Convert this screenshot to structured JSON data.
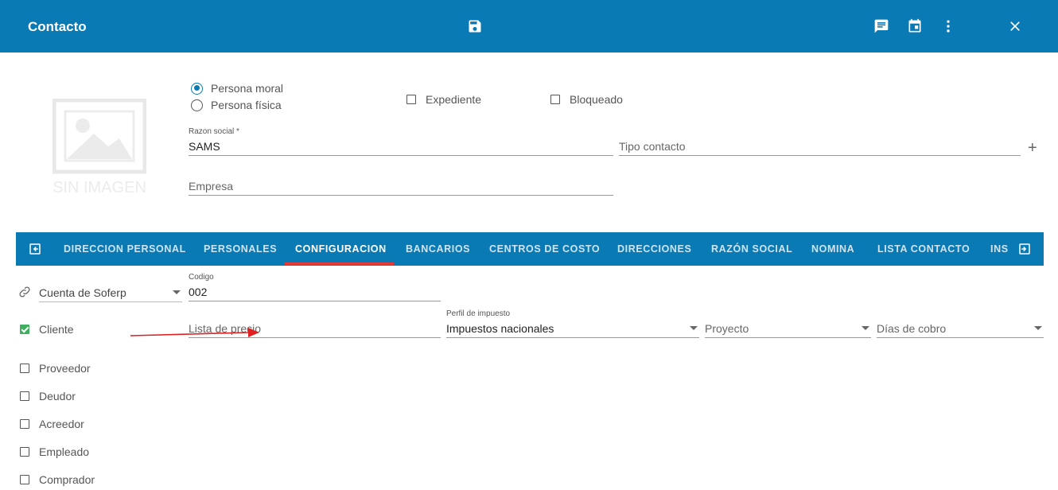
{
  "header": {
    "title": "Contacto",
    "icons": [
      "save-icon",
      "comment-icon",
      "calendar-icon",
      "more-vert-icon",
      "close-icon"
    ]
  },
  "avatar": {
    "icon": "image-placeholder-icon",
    "caption": "SIN IMAGEN"
  },
  "persona": {
    "options": [
      "Persona moral",
      "Persona física"
    ],
    "selected": "Persona moral"
  },
  "flags": {
    "expediente": "Expediente",
    "bloqueado": "Bloqueado"
  },
  "form": {
    "razon_social_label": "Razon social *",
    "razon_social_value": "SAMS",
    "tipo_contacto_placeholder": "Tipo contacto",
    "empresa_placeholder": "Empresa"
  },
  "tabs": {
    "items": [
      "DIRECCION PERSONAL",
      "PERSONALES",
      "CONFIGURACION",
      "BANCARIOS",
      "CENTROS DE COSTO",
      "DIRECCIONES",
      "RAZÓN SOCIAL",
      "NOMINA",
      "LISTA CONTACTO",
      "INS"
    ],
    "active": "CONFIGURACION"
  },
  "config": {
    "cuenta_value": "Cuenta de Soferp",
    "codigo_label": "Codigo",
    "codigo_value": "002",
    "lista_precio_placeholder": "Lista de precio",
    "perfil_label": "Perfil de impuesto",
    "perfil_value": "Impuestos nacionales",
    "proyecto_placeholder": "Proyecto",
    "dias_cobro_placeholder": "Días de cobro"
  },
  "roles": [
    {
      "label": "Cliente",
      "checked": true
    },
    {
      "label": "Proveedor",
      "checked": false
    },
    {
      "label": "Deudor",
      "checked": false
    },
    {
      "label": "Acreedor",
      "checked": false
    },
    {
      "label": "Empleado",
      "checked": false
    },
    {
      "label": "Comprador",
      "checked": false
    }
  ],
  "colors": {
    "primary": "#0a7ab5",
    "active_tab_underline": "#e53935",
    "check_green": "#3fae5e",
    "annotation_arrow": "#e02020"
  }
}
